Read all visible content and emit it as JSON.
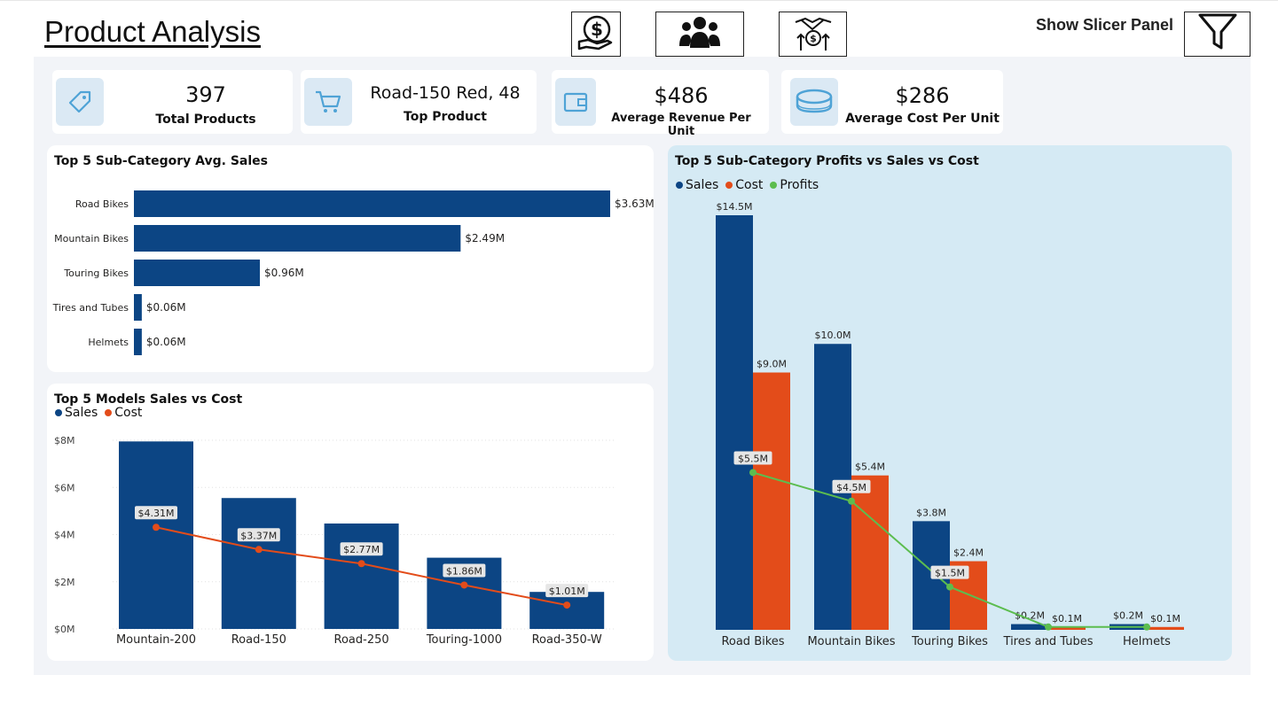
{
  "header": {
    "title": "Product Analysis",
    "slicer_label": "Show Slicer Panel",
    "nav_icons": [
      "money-hand-icon",
      "people-icon",
      "handshake-money-icon"
    ],
    "filter_icon": "filter-icon"
  },
  "kpis": [
    {
      "value": "397",
      "label": "Total Products",
      "icon": "tag-icon"
    },
    {
      "value": "Road-150 Red, 48",
      "label": "Top Product",
      "icon": "cart-icon"
    },
    {
      "value": "$486",
      "label": "Average Revenue Per Unit",
      "icon": "wallet-icon"
    },
    {
      "value": "$286",
      "label": "Average Cost Per Unit",
      "icon": "coins-icon"
    }
  ],
  "colors": {
    "sales": "#0c4584",
    "cost": "#e34c1a",
    "profits": "#5cbd4f",
    "accent_bg": "#d5eaf4"
  },
  "chart_data": [
    {
      "id": "subcat_avg_sales",
      "type": "bar",
      "orientation": "horizontal",
      "title": "Top 5 Sub-Category Avg. Sales",
      "categories": [
        "Road Bikes",
        "Mountain Bikes",
        "Touring Bikes",
        "Tires and Tubes",
        "Helmets"
      ],
      "values": [
        3.63,
        2.49,
        0.96,
        0.06,
        0.06
      ],
      "data_labels": [
        "$3.63M",
        "$2.49M",
        "$0.96M",
        "$0.06M",
        "$0.06M"
      ],
      "unit": "M"
    },
    {
      "id": "models_sales_cost",
      "type": "bar",
      "title": "Top 5 Models Sales vs Cost",
      "legend": [
        "Sales",
        "Cost"
      ],
      "categories": [
        "Mountain-200",
        "Road-150",
        "Road-250",
        "Touring-1000",
        "Road-350-W"
      ],
      "series": [
        {
          "name": "Sales",
          "kind": "bar",
          "values": [
            7.95,
            5.55,
            4.47,
            3.02,
            1.57
          ]
        },
        {
          "name": "Cost",
          "kind": "line",
          "values": [
            4.31,
            3.37,
            2.77,
            1.86,
            1.01
          ],
          "labels": [
            "$4.31M",
            "$3.37M",
            "$2.77M",
            "$1.86M",
            "$1.01M"
          ]
        }
      ],
      "ylim": [
        0,
        8
      ],
      "yticks": [
        "$0M",
        "$2M",
        "$4M",
        "$6M",
        "$8M"
      ],
      "grid": true,
      "legend_position": "top-left"
    },
    {
      "id": "subcat_profit_sales_cost",
      "type": "bar",
      "title": "Top 5 Sub-Category Profits vs Sales vs Cost",
      "legend": [
        "Sales",
        "Cost",
        "Profits"
      ],
      "categories": [
        "Road Bikes",
        "Mountain Bikes",
        "Touring Bikes",
        "Tires and Tubes",
        "Helmets"
      ],
      "series": [
        {
          "name": "Sales",
          "kind": "bar",
          "values": [
            14.5,
            10.0,
            3.8,
            0.2,
            0.2
          ],
          "labels": [
            "$14.5M",
            "$10.0M",
            "$3.8M",
            "$0.2M",
            "$0.2M"
          ]
        },
        {
          "name": "Cost",
          "kind": "bar",
          "values": [
            9.0,
            5.4,
            2.4,
            0.1,
            0.1
          ],
          "labels": [
            "$9.0M",
            "$5.4M",
            "$2.4M",
            "$0.1M",
            "$0.1M"
          ]
        },
        {
          "name": "Profits",
          "kind": "line",
          "values": [
            5.5,
            4.5,
            1.5,
            0.1,
            0.1
          ],
          "labels": [
            "$5.5M",
            "$4.5M",
            "$1.5M",
            "",
            ""
          ]
        }
      ],
      "ylim": [
        0,
        14.5
      ],
      "legend_position": "top-left"
    }
  ]
}
